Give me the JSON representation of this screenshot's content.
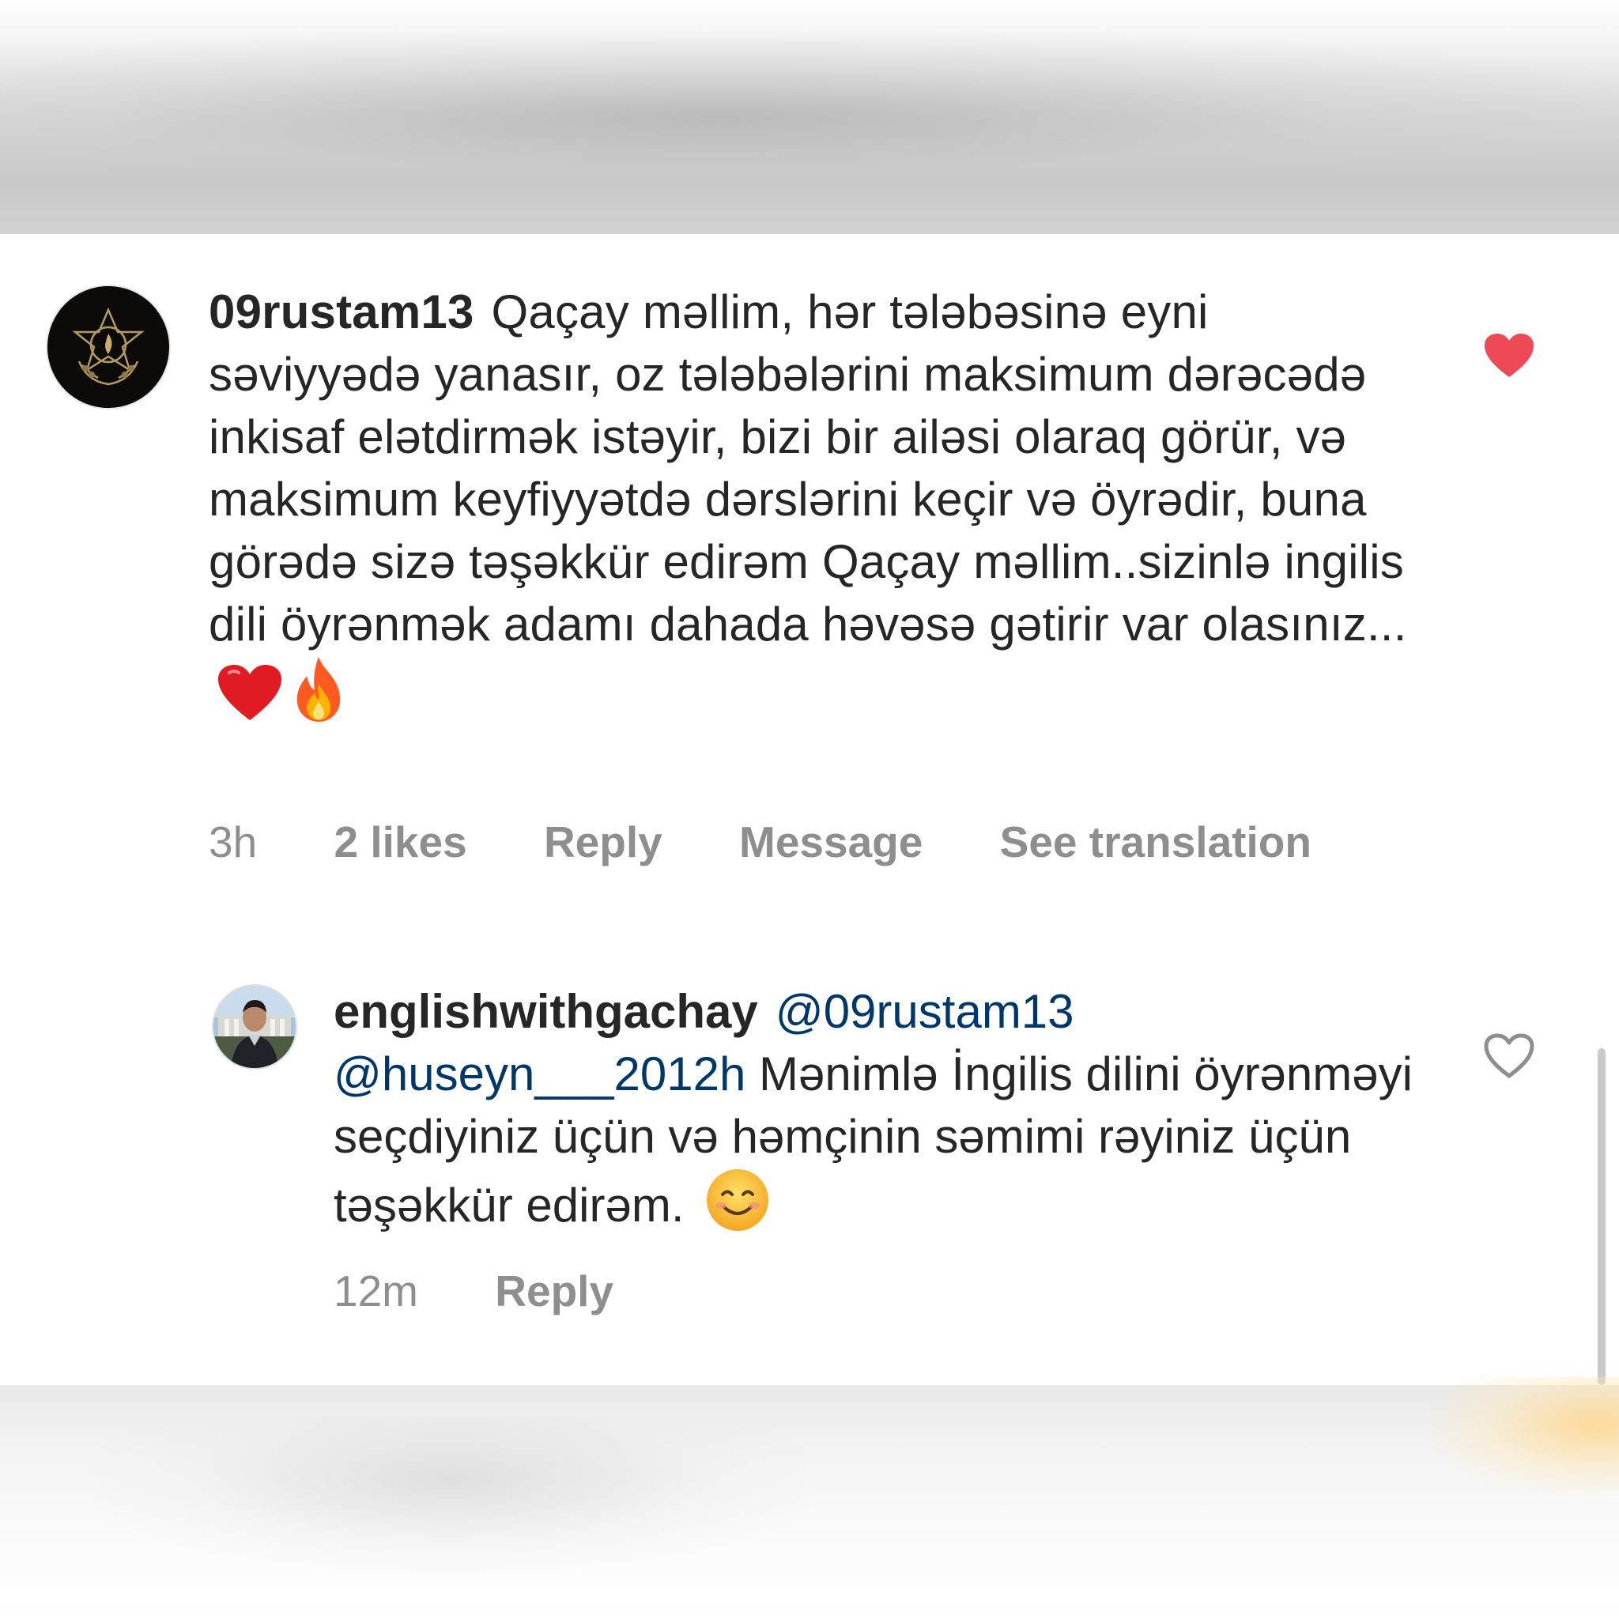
{
  "comments": [
    {
      "username": "09rustam13",
      "text": "Qaçay məllim, hər tələbəsinə eyni səviyyədə yanasır, oz tələbələrini maksimum dərəcədə inkisaf elətdirmək istəyir, bizi bir ailəsi olaraq görür, və maksimum keyfiyyətdə dərslərini keçir və öyrədir, buna görədə sizə təşəkkür edirəm Qaçay məllim..sizinlə ingilis dili öyrənmək adamı dahada həvəsə gətirir var olasınız...",
      "emojis": [
        "❤️",
        "🔥"
      ],
      "time": "3h",
      "likes": "2 likes",
      "actions": [
        "Reply",
        "Message",
        "See translation"
      ],
      "liked": true,
      "like_icon": "heart-filled-icon",
      "like_color": "#ed4956"
    },
    {
      "username": "englishwithgachay",
      "mentions": [
        "@09rustam13",
        "@huseyn___2012h"
      ],
      "text": "Mənimlə İngilis dilini öyrənməyi seçdiyiniz üçün və həmçinin səmimi rəyiniz üçün təşəkkür edirəm.",
      "emoji": "😊",
      "time": "12m",
      "actions": [
        "Reply"
      ],
      "liked": false,
      "like_icon": "heart-outline-icon"
    }
  ],
  "colors": {
    "text": "#262626",
    "meta": "#8e8e8e",
    "mention": "#00376b",
    "like": "#ed4956"
  }
}
